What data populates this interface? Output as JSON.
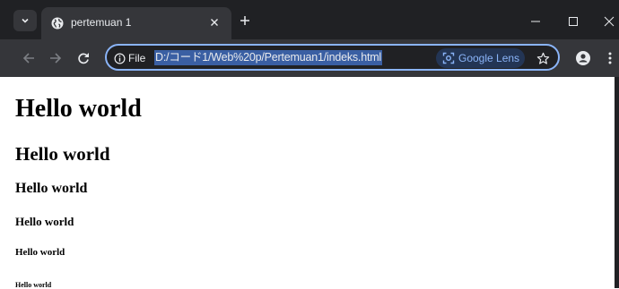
{
  "tab": {
    "title": "pertemuan 1"
  },
  "toolbar": {
    "chip_label": "File",
    "url": "D:/コード1/Web%20p/Pertemuan1/indeks.html",
    "lens_label": "Google Lens"
  },
  "page": {
    "headings": [
      "Hello world",
      "Hello world",
      "Hello world",
      "Hello world",
      "Hello world",
      "Hello world"
    ]
  }
}
